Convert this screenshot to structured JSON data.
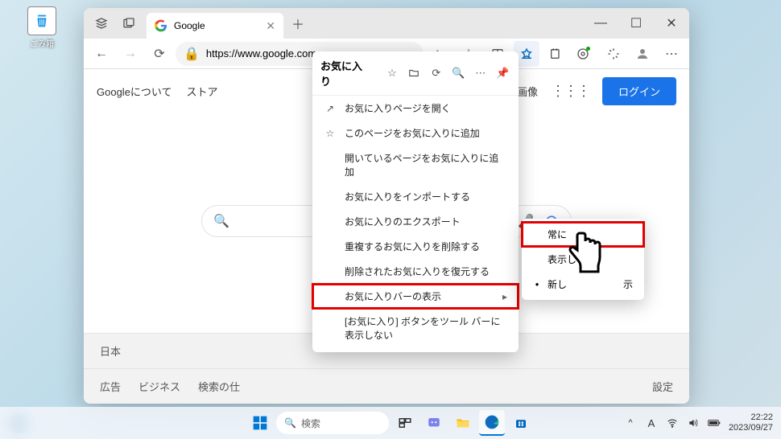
{
  "desktop": {
    "recycle_label": "ごみ箱"
  },
  "window": {
    "tab_title": "Google",
    "url": "https://www.google.com"
  },
  "google": {
    "top_links": {
      "about": "Googleについて",
      "store": "ストア",
      "images": "画像",
      "login": "ログイン"
    },
    "footer": {
      "country": "日本",
      "ads": "広告",
      "business": "ビジネス",
      "how": "検索の仕",
      "settings": "設定"
    }
  },
  "favorites": {
    "title": "お気に入り",
    "items": [
      "お気に入りページを開く",
      "このページをお気に入りに追加",
      "開いているページをお気に入りに追加",
      "お気に入りをインポートする",
      "お気に入りのエクスポート",
      "重複するお気に入りを削除する",
      "削除されたお気に入りを復元する",
      "お気に入りバーの表示",
      "[お気に入り] ボタンをツール バーに表示しない"
    ]
  },
  "submenu": {
    "items": [
      "常に",
      "表示しな",
      "新し"
    ],
    "item2_suffix": "示"
  },
  "taskbar": {
    "search_placeholder": "検索",
    "ime": "A",
    "time": "22:22",
    "date": "2023/09/27"
  }
}
